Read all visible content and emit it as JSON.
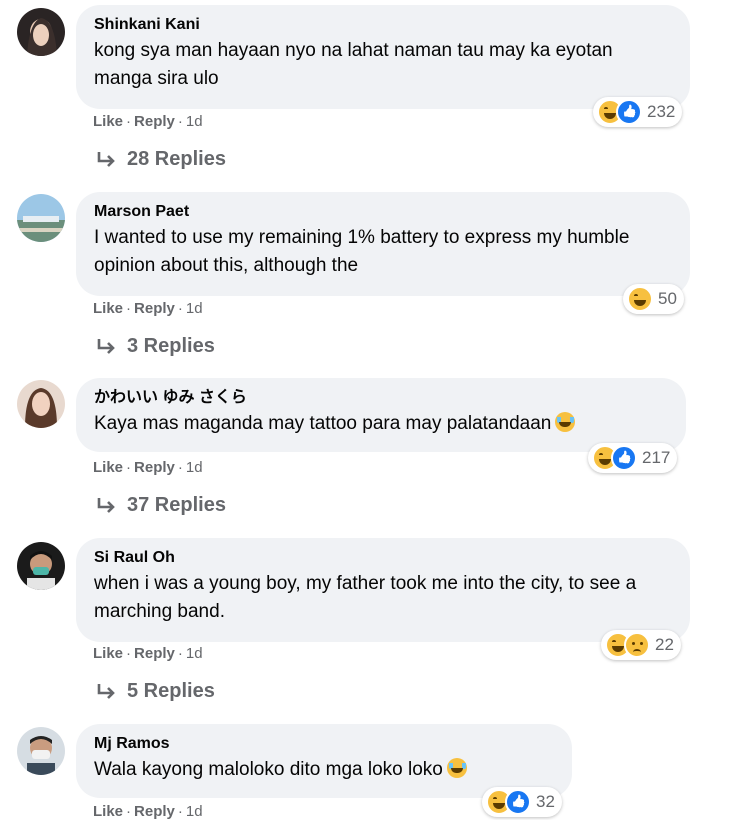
{
  "actions": {
    "like": "Like",
    "reply": "Reply",
    "dot": "·"
  },
  "comments": [
    {
      "author": "Shinkani Kani",
      "text": "kong sya man hayaan nyo na lahat naman tau may ka eyotan manga sira ulo",
      "time": "1d",
      "reaction_count": "232",
      "reaction_icons": [
        "haha-icon",
        "like-icon"
      ],
      "replies": "28 Replies"
    },
    {
      "author": "Marson Paet",
      "text": "I wanted to use my remaining 1% battery to express my humble opinion about this, although the",
      "time": "1d",
      "reaction_count": "50",
      "reaction_icons": [
        "haha-icon"
      ],
      "replies": "3 Replies"
    },
    {
      "author": "かわいい ゆみ さくら",
      "text": "Kaya mas maganda may tattoo para may palatandaan",
      "text_emoji": "tears-of-joy-emoji",
      "time": "1d",
      "reaction_count": "217",
      "reaction_icons": [
        "haha-icon",
        "like-icon"
      ],
      "replies": "37 Replies"
    },
    {
      "author": "Si Raul Oh",
      "text": "when i was a young boy, my father took me into the city, to see a marching band.",
      "time": "1d",
      "reaction_count": "22",
      "reaction_icons": [
        "haha-icon",
        "sad-icon"
      ],
      "replies": "5 Replies"
    },
    {
      "author": "Mj Ramos",
      "text": "Wala kayong maloloko dito mga loko loko",
      "text_emoji": "rolling-laughing-emoji",
      "time": "1d",
      "reaction_count": "32",
      "reaction_icons": [
        "haha-icon",
        "like-icon"
      ]
    }
  ]
}
